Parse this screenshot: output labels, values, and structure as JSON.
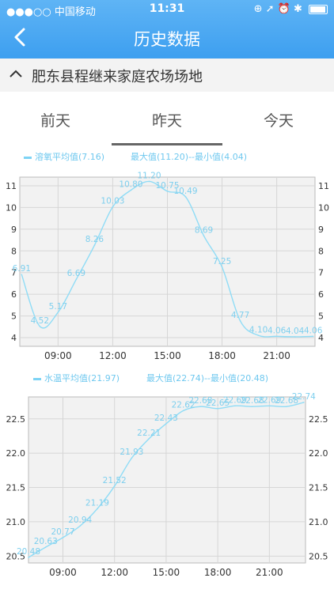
{
  "status_bar": {
    "carrier": "●●●○○ 中国移动",
    "time": "11:31",
    "right": "⊕ ➚ ⏰ ✱"
  },
  "header": {
    "title": "历史数据"
  },
  "farm": {
    "name": "肥东县程继来家庭农场场地"
  },
  "tabs": [
    {
      "label": "前天"
    },
    {
      "label": "昨天"
    },
    {
      "label": "今天"
    }
  ],
  "selected_tab": "昨天",
  "colors": {
    "accent": "#4aa8f2",
    "series": "#8fdcf6",
    "label": "#7ecfee",
    "grid": "#d6d6d6",
    "plot_bg": "#f2f2f2"
  },
  "chart_data": [
    {
      "type": "line",
      "legend": "溶氧平均值(7.16)",
      "summary": "最大值(11.20)--最小值(4.04)",
      "xlabel": "",
      "ylabel": "",
      "ylim": [
        3.6,
        11.4
      ],
      "yticks": [
        4,
        5,
        6,
        7,
        8,
        9,
        10,
        11
      ],
      "xticks": [
        {
          "label": "09:00",
          "x": 9
        },
        {
          "label": "12:00",
          "x": 12
        },
        {
          "label": "15:00",
          "x": 15
        },
        {
          "label": "18:00",
          "x": 18
        },
        {
          "label": "21:00",
          "x": 21
        }
      ],
      "xlim": [
        6.9,
        23.1
      ],
      "series": [
        {
          "points": [
            {
              "x": 7,
              "y": 6.91,
              "label": "6.91"
            },
            {
              "x": 8,
              "y": 4.52,
              "label": "4.52"
            },
            {
              "x": 9,
              "y": 5.17,
              "label": "5.17"
            },
            {
              "x": 10,
              "y": 6.69,
              "label": "6.69"
            },
            {
              "x": 11,
              "y": 8.26,
              "label": "8.26"
            },
            {
              "x": 12,
              "y": 10.03,
              "label": "10.03"
            },
            {
              "x": 13,
              "y": 10.8,
              "label": "10.80"
            },
            {
              "x": 14,
              "y": 11.2,
              "label": "11.20"
            },
            {
              "x": 15,
              "y": 10.75,
              "label": "10.75"
            },
            {
              "x": 16,
              "y": 10.49,
              "label": "10.49"
            },
            {
              "x": 17,
              "y": 8.69,
              "label": "8.69"
            },
            {
              "x": 18,
              "y": 7.25,
              "label": "7.25"
            },
            {
              "x": 19,
              "y": 4.77,
              "label": "4.77"
            },
            {
              "x": 20,
              "y": 4.1,
              "label": "4.10"
            },
            {
              "x": 21,
              "y": 4.06,
              "label": "4.06"
            },
            {
              "x": 22,
              "y": 4.04,
              "label": "4.04"
            },
            {
              "x": 23,
              "y": 4.06,
              "label": "4.06"
            }
          ]
        }
      ]
    },
    {
      "type": "line",
      "legend": "水温平均值(21.97)",
      "summary": "最大值(22.74)--最小值(20.48)",
      "xlabel": "",
      "ylabel": "",
      "ylim": [
        20.4,
        22.82
      ],
      "yticks": [
        20.5,
        21.0,
        21.5,
        22.0,
        22.5
      ],
      "ytick_labels": [
        "20.5",
        "21.0",
        "21.5",
        "22.0",
        "22.5"
      ],
      "xticks": [
        {
          "label": "09:00",
          "x": 9
        },
        {
          "label": "12:00",
          "x": 12
        },
        {
          "label": "15:00",
          "x": 15
        },
        {
          "label": "18:00",
          "x": 18
        },
        {
          "label": "21:00",
          "x": 21
        }
      ],
      "xlim": [
        7.0,
        23.1
      ],
      "series": [
        {
          "points": [
            {
              "x": 7,
              "y": 20.48,
              "label": "20.48"
            },
            {
              "x": 8,
              "y": 20.63,
              "label": "20.63"
            },
            {
              "x": 9,
              "y": 20.77,
              "label": "20.77"
            },
            {
              "x": 10,
              "y": 20.94,
              "label": "20.94"
            },
            {
              "x": 11,
              "y": 21.19,
              "label": "21.19"
            },
            {
              "x": 12,
              "y": 21.52,
              "label": "21.52"
            },
            {
              "x": 13,
              "y": 21.93,
              "label": "21.93"
            },
            {
              "x": 14,
              "y": 22.21,
              "label": "22.21"
            },
            {
              "x": 15,
              "y": 22.43,
              "label": "22.43"
            },
            {
              "x": 16,
              "y": 22.62,
              "label": "22.62"
            },
            {
              "x": 17,
              "y": 22.68,
              "label": "22.68"
            },
            {
              "x": 18,
              "y": 22.65,
              "label": "22.65"
            },
            {
              "x": 19,
              "y": 22.69,
              "label": "22.69"
            },
            {
              "x": 20,
              "y": 22.68,
              "label": "22.68"
            },
            {
              "x": 21,
              "y": 22.69,
              "label": "22.69"
            },
            {
              "x": 22,
              "y": 22.68,
              "label": "22.68"
            },
            {
              "x": 23,
              "y": 22.74,
              "label": "22.74"
            }
          ]
        }
      ]
    }
  ]
}
